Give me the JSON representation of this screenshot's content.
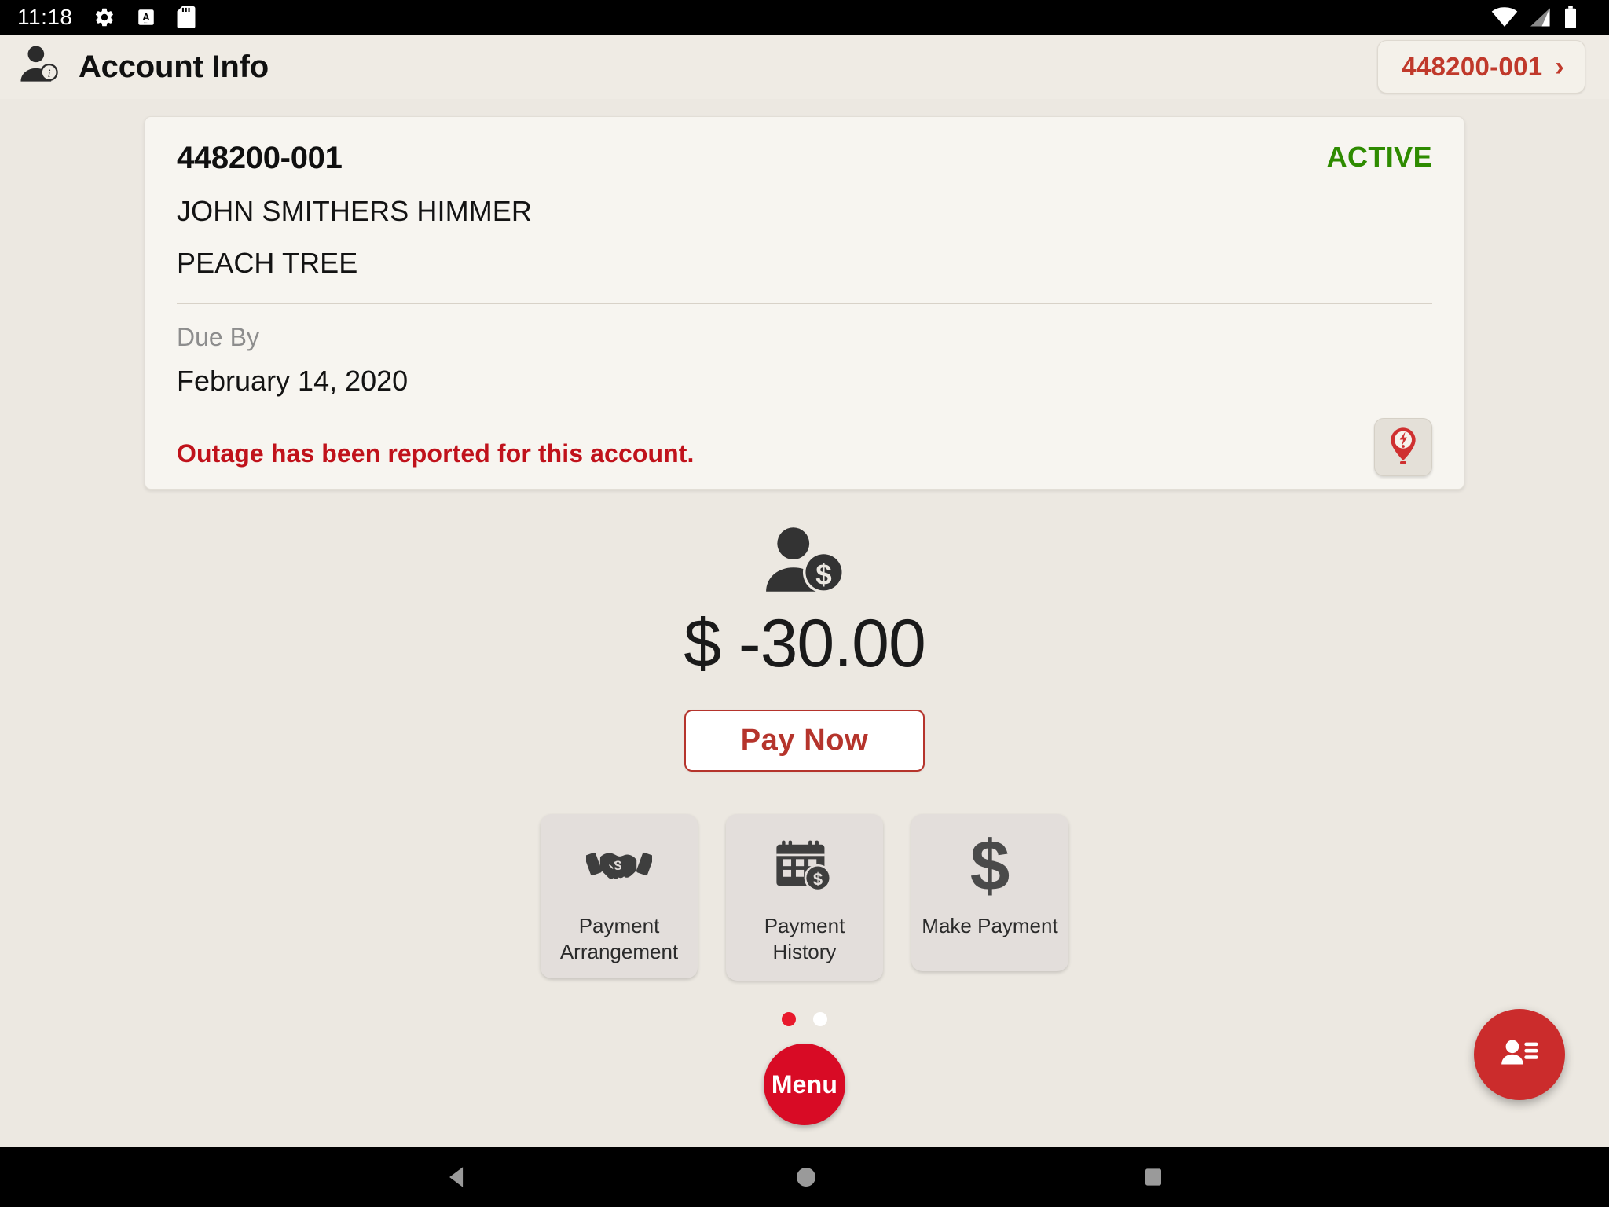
{
  "status_bar": {
    "clock": "11:18",
    "left_icons": [
      "gear-icon",
      "android-auto-rotate-icon",
      "sd-card-icon"
    ],
    "right_icons": [
      "wifi-icon",
      "cellular-signal-icon",
      "battery-icon"
    ]
  },
  "app_bar": {
    "icon": "account-info-icon",
    "title": "Account Info",
    "account_chip": {
      "label": "448200-001",
      "chevron": "›"
    }
  },
  "account_card": {
    "account_number": "448200-001",
    "status": "ACTIVE",
    "status_color": "#2e8b00",
    "customer_name": "JOHN SMITHERS HIMMER",
    "address": "PEACH TREE",
    "due_by_label": "Due By",
    "due_by_date": "February 14, 2020",
    "outage_message": "Outage has been reported for this account.",
    "outage_message_color": "#c0121b",
    "outage_button_icon": "outage-pin-icon"
  },
  "balance": {
    "icon": "person-dollar-icon",
    "amount": "$ -30.00",
    "pay_now_label": "Pay Now",
    "pay_now_color": "#b5342c"
  },
  "tiles": [
    {
      "icon": "handshake-dollar-icon",
      "label": "Payment\nArrangement",
      "line1": "Payment",
      "line2": "Arrangement"
    },
    {
      "icon": "calendar-dollar-icon",
      "label": "Payment\nHistory",
      "line1": "Payment",
      "line2": "History"
    },
    {
      "icon": "dollar-sign-icon",
      "label": "Make Payment",
      "line1": "Make Payment",
      "line2": ""
    }
  ],
  "pager": {
    "total": 2,
    "active_index": 0,
    "active_color": "#e8192c",
    "inactive_color": "#ffffff"
  },
  "menu_fab": {
    "label": "Menu",
    "color": "#d80b25"
  },
  "accounts_fab": {
    "icon": "contact-list-icon",
    "color": "#cb2c2c"
  },
  "nav_bar": {
    "buttons": [
      "back-nav-icon",
      "home-nav-icon",
      "recents-nav-icon"
    ]
  }
}
